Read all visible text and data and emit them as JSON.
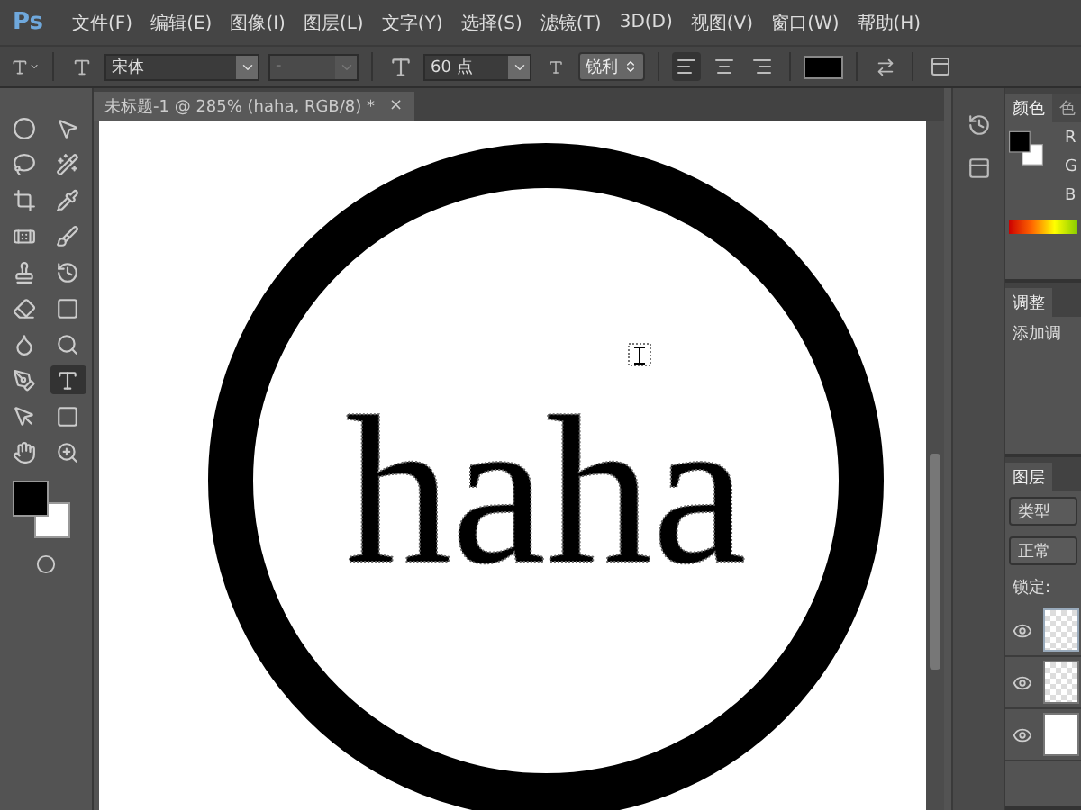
{
  "app_logo": "Ps",
  "menu": [
    "文件(F)",
    "编辑(E)",
    "图像(I)",
    "图层(L)",
    "文字(Y)",
    "选择(S)",
    "滤镜(T)",
    "3D(D)",
    "视图(V)",
    "窗口(W)",
    "帮助(H)"
  ],
  "options_bar": {
    "font_family": "宋体",
    "font_style": {
      "value": "-",
      "disabled": true
    },
    "font_size": "60 点",
    "antialias": "锐利",
    "align": [
      {
        "kind": "left",
        "selected": true
      },
      {
        "kind": "center",
        "selected": false
      },
      {
        "kind": "right",
        "selected": false
      }
    ]
  },
  "document_tab": {
    "title": "未标题-1 @ 285% (haha, RGB/8) *",
    "close": "×"
  },
  "tools": [
    {
      "kind": "marquee",
      "selected": false
    },
    {
      "kind": "move",
      "selected": false
    },
    {
      "kind": "lasso",
      "selected": false
    },
    {
      "kind": "quick",
      "selected": false
    },
    {
      "kind": "crop",
      "selected": false
    },
    {
      "kind": "eyedropper",
      "selected": false
    },
    {
      "kind": "heal",
      "selected": false
    },
    {
      "kind": "brush",
      "selected": false
    },
    {
      "kind": "stamp",
      "selected": false
    },
    {
      "kind": "history",
      "selected": false
    },
    {
      "kind": "eraser",
      "selected": false
    },
    {
      "kind": "gradient",
      "selected": false
    },
    {
      "kind": "blur",
      "selected": false
    },
    {
      "kind": "dodge",
      "selected": false
    },
    {
      "kind": "pen",
      "selected": false
    },
    {
      "kind": "type",
      "selected": true
    },
    {
      "kind": "path",
      "selected": false
    },
    {
      "kind": "shape",
      "selected": false
    },
    {
      "kind": "hand",
      "selected": false
    },
    {
      "kind": "zoom",
      "selected": false
    }
  ],
  "canvas": {
    "text": "haha"
  },
  "color_panel": {
    "tabs": [
      {
        "label": "颜色",
        "selected": true
      },
      {
        "label": "色",
        "selected": false
      }
    ],
    "channels": [
      "R",
      "G",
      "B"
    ]
  },
  "adjust_panel": {
    "tabs": [
      {
        "label": "调整",
        "selected": true
      }
    ],
    "hint": "添加调"
  },
  "layers_panel": {
    "tabs": [
      {
        "label": "图层",
        "selected": true
      }
    ],
    "filter": "类型",
    "blend": "正常",
    "lock": "锁定:",
    "layers": [
      {
        "kind": "text",
        "visible": true,
        "selected": true
      },
      {
        "kind": "ring",
        "visible": true,
        "selected": false
      },
      {
        "kind": "white",
        "visible": true,
        "selected": false
      }
    ]
  }
}
